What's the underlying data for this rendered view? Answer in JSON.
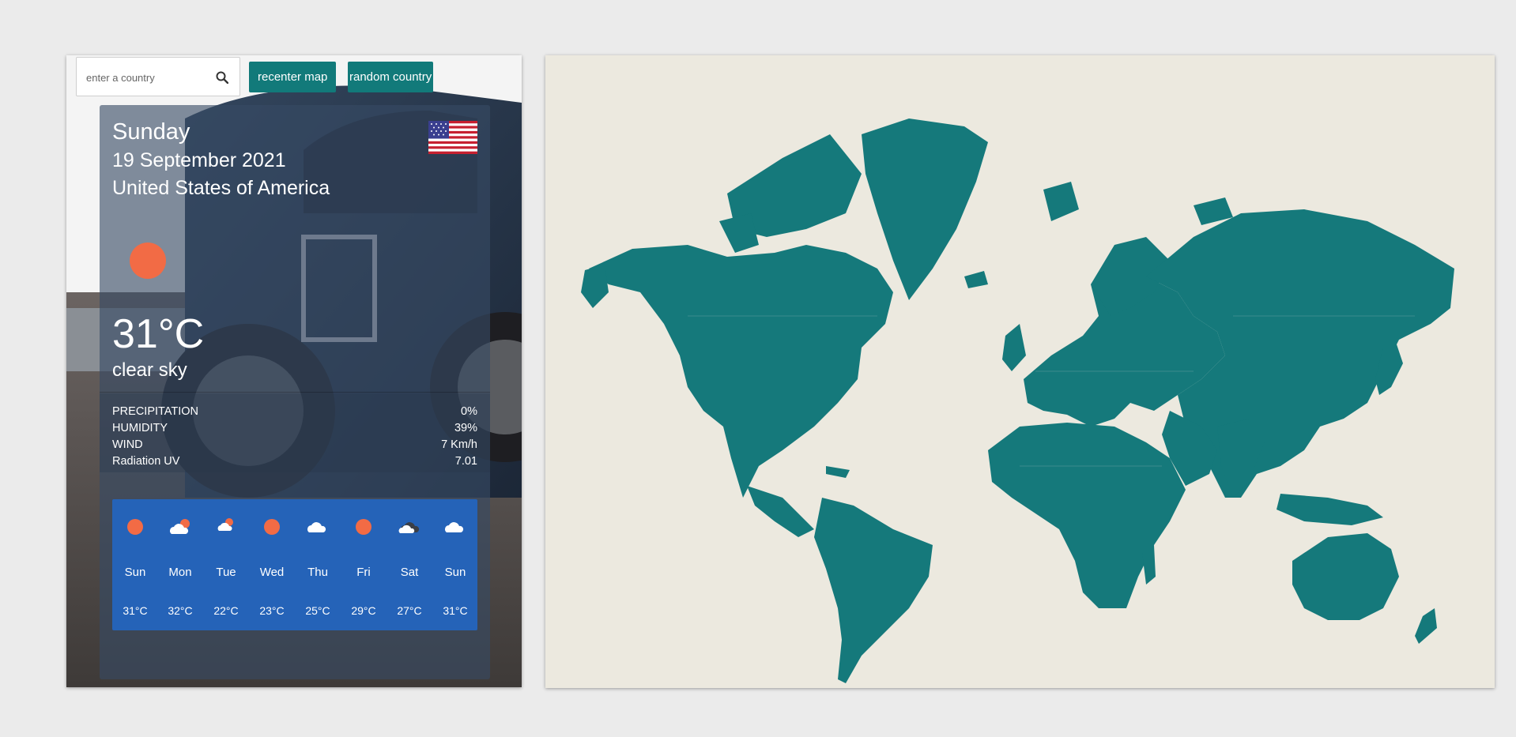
{
  "search": {
    "placeholder": "enter a country"
  },
  "buttons": {
    "recenter": "recenter map",
    "random": "random country"
  },
  "weather": {
    "day": "Sunday",
    "date": "19 September 2021",
    "country": "United States of America",
    "temperature": "31°C",
    "condition": "clear sky",
    "stats": [
      {
        "label": "PRECIPITATION",
        "value": "0%"
      },
      {
        "label": "HUMIDITY",
        "value": "39%"
      },
      {
        "label": "WIND",
        "value": "7 Km/h"
      },
      {
        "label": "Radiation UV",
        "value": "7.01"
      }
    ],
    "forecast": [
      {
        "day": "Sun",
        "temp": "31°C",
        "icon": "sun-icon"
      },
      {
        "day": "Mon",
        "temp": "32°C",
        "icon": "cloud-sun-icon"
      },
      {
        "day": "Tue",
        "temp": "22°C",
        "icon": "cloud-sun-icon"
      },
      {
        "day": "Wed",
        "temp": "23°C",
        "icon": "sun-icon"
      },
      {
        "day": "Thu",
        "temp": "25°C",
        "icon": "cloud-icon"
      },
      {
        "day": "Fri",
        "temp": "29°C",
        "icon": "sun-icon"
      },
      {
        "day": "Sat",
        "temp": "27°C",
        "icon": "dark-cloud-icon"
      },
      {
        "day": "Sun",
        "temp": "31°C",
        "icon": "cloud-icon"
      }
    ]
  },
  "colors": {
    "accent_teal": "#127a7a",
    "forecast_blue": "#2563b8",
    "sun_orange": "#f26b45",
    "map_land": "#15797b",
    "map_sea": "#ece9df"
  }
}
